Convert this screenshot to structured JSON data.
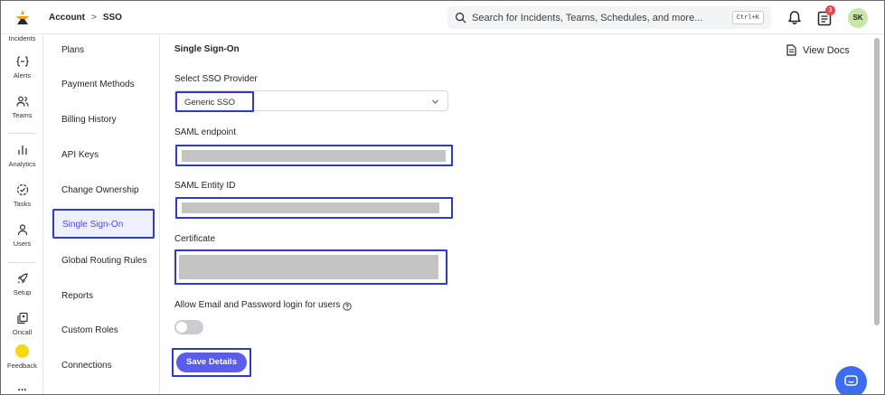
{
  "header": {
    "breadcrumb": [
      "Account",
      "SSO"
    ],
    "breadcrumb_separator": ">",
    "search_placeholder": "Search for Incidents, Teams, Schedules, and more...",
    "search_shortcut": "Ctrl+K",
    "notification_count": "3",
    "user_initials": "SK",
    "brand_color": "#f59e0b"
  },
  "rail": {
    "items": [
      {
        "label": "Incidents",
        "icon": "incidents-icon"
      },
      {
        "label": "Alerts",
        "icon": "alerts-icon"
      },
      {
        "label": "Teams",
        "icon": "teams-icon"
      },
      {
        "label": "Analytics",
        "icon": "analytics-icon"
      },
      {
        "label": "Tasks",
        "icon": "tasks-icon"
      },
      {
        "label": "Users",
        "icon": "users-icon"
      },
      {
        "label": "Setup",
        "icon": "setup-icon"
      },
      {
        "label": "Oncall",
        "icon": "oncall-icon"
      },
      {
        "label": "Feedback",
        "icon": "feedback-icon"
      }
    ],
    "more": "..."
  },
  "subnav": {
    "items": [
      "Plans",
      "Payment Methods",
      "Billing History",
      "API Keys",
      "Change Ownership",
      "Single Sign-On",
      "Global Routing Rules",
      "Reports",
      "Custom Roles",
      "Connections"
    ],
    "active": "Single Sign-On"
  },
  "main": {
    "title": "Single Sign-On",
    "view_docs": "View Docs",
    "provider_label": "Select SSO Provider",
    "provider_value": "Generic SSO",
    "saml_endpoint_label": "SAML endpoint",
    "saml_entity_label": "SAML Entity ID",
    "certificate_label": "Certificate",
    "allow_login_label": "Allow Email and Password login for users",
    "allow_login_enabled": false,
    "save_label": "Save Details",
    "accent_color": "#5b5bf0",
    "highlight_color": "#2c3bc9"
  }
}
